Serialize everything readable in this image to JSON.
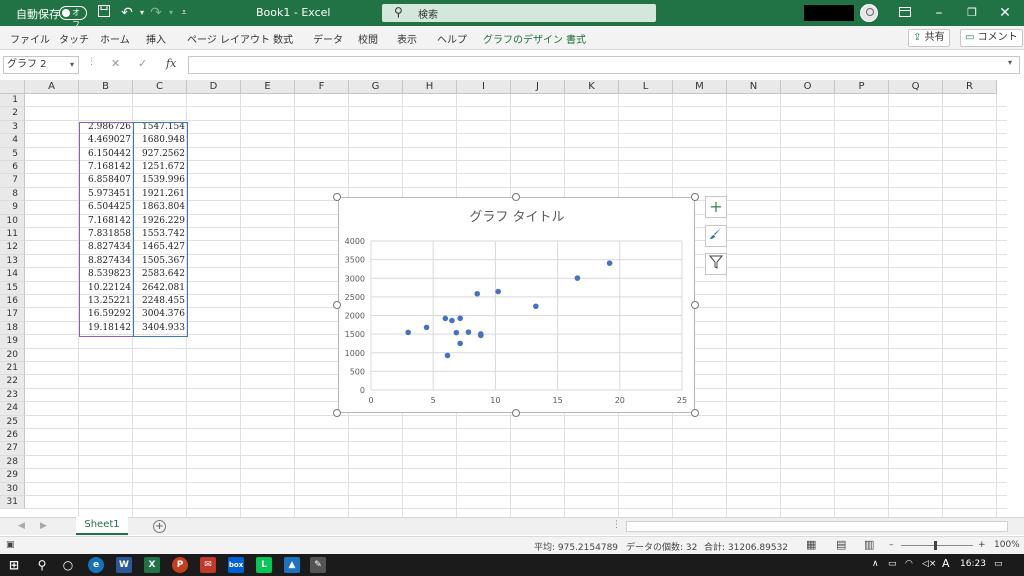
{
  "titlebar": {
    "autosave_label": "自動保存",
    "autosave_state": "オフ",
    "doc_title": "Book1 - Excel",
    "search_placeholder": "検索"
  },
  "ribbon": {
    "tabs": [
      "ファイル",
      "タッチ",
      "ホーム",
      "挿入",
      "ページ レイアウト",
      "数式",
      "データ",
      "校閲",
      "表示",
      "ヘルプ",
      "グラフのデザイン",
      "書式"
    ],
    "share_label": "共有",
    "comment_label": "コメント"
  },
  "formula_bar": {
    "name_box": "グラフ 2",
    "fx_label": "fx",
    "formula": ""
  },
  "sheet": {
    "columns": [
      "A",
      "B",
      "C",
      "D",
      "E",
      "F",
      "G",
      "H",
      "I",
      "J",
      "K",
      "L",
      "M",
      "N",
      "O",
      "P",
      "Q",
      "R"
    ],
    "rows": [
      "1",
      "2",
      "3",
      "4",
      "5",
      "6",
      "7",
      "8",
      "9",
      "10",
      "11",
      "12",
      "13",
      "14",
      "15",
      "16",
      "17",
      "18",
      "19",
      "20",
      "21",
      "22",
      "23",
      "24",
      "25",
      "26",
      "27",
      "28",
      "29",
      "30",
      "31"
    ],
    "data_rows": [
      {
        "b": "2.986726",
        "c": "1547.154"
      },
      {
        "b": "4.469027",
        "c": "1680.948"
      },
      {
        "b": "6.150442",
        "c": "927.2562"
      },
      {
        "b": "7.168142",
        "c": "1251.672"
      },
      {
        "b": "6.858407",
        "c": "1539.996"
      },
      {
        "b": "5.973451",
        "c": "1921.261"
      },
      {
        "b": "6.504425",
        "c": "1863.804"
      },
      {
        "b": "7.168142",
        "c": "1926.229"
      },
      {
        "b": "7.831858",
        "c": "1553.742"
      },
      {
        "b": "8.827434",
        "c": "1465.427"
      },
      {
        "b": "8.827434",
        "c": "1505.367"
      },
      {
        "b": "8.539823",
        "c": "2583.642"
      },
      {
        "b": "10.22124",
        "c": "2642.081"
      },
      {
        "b": "13.25221",
        "c": "2248.455"
      },
      {
        "b": "16.59292",
        "c": "3004.376"
      },
      {
        "b": "19.18142",
        "c": "3404.933"
      }
    ]
  },
  "chart_data": {
    "type": "scatter",
    "title": "グラフ タイトル",
    "xlabel": "",
    "ylabel": "",
    "xlim": [
      0,
      25
    ],
    "ylim": [
      0,
      4000
    ],
    "x_ticks": [
      "0",
      "5",
      "10",
      "15",
      "20",
      "25"
    ],
    "y_ticks": [
      "0",
      "500",
      "1000",
      "1500",
      "2000",
      "2500",
      "3000",
      "3500",
      "4000"
    ],
    "grid": true,
    "legend": "none",
    "series": [
      {
        "color": "#4472c4",
        "x": [
          2.986726,
          4.469027,
          6.150442,
          7.168142,
          6.858407,
          5.973451,
          6.504425,
          7.168142,
          7.831858,
          8.827434,
          8.827434,
          8.539823,
          10.22124,
          13.25221,
          16.59292,
          19.18142
        ],
        "y": [
          1547.154,
          1680.948,
          927.2562,
          1251.672,
          1539.996,
          1921.261,
          1863.804,
          1926.229,
          1553.742,
          1465.427,
          1505.367,
          2583.642,
          2642.081,
          2248.455,
          3004.376,
          3404.933
        ]
      }
    ]
  },
  "chart_side_buttons": [
    "add-chart-element-icon",
    "chart-styles-icon",
    "chart-filter-icon"
  ],
  "sheet_tabs": [
    "Sheet1"
  ],
  "status_bar": {
    "average": "平均: 975.2154789",
    "count": "データの個数: 32",
    "sum": "合計: 31206.89532",
    "zoom": "100%"
  },
  "taskbar": {
    "time": "16:23",
    "ime": "A"
  },
  "colors": {
    "excel_green": "#217346",
    "marker_blue": "#4472c4",
    "range_purple": "#8b5fbf",
    "range_blue": "#3b78c4"
  }
}
